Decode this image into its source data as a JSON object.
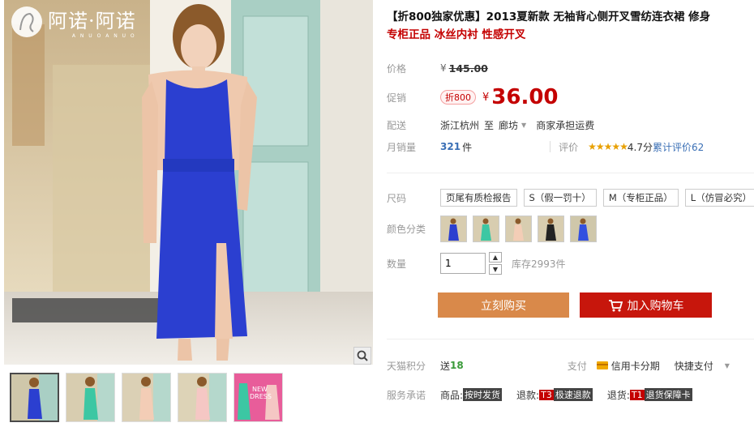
{
  "brand": {
    "name": "阿诺·阿诺",
    "sub": "A N U O A N U O"
  },
  "product": {
    "title": "【折800独家优惠】2013夏新款 无袖背心侧开叉雪纺连衣裙 修身",
    "subtitle": "专柜正品 冰丝内衬 性感开叉"
  },
  "price": {
    "label": "价格",
    "currency": "¥",
    "original": "145.00"
  },
  "promo": {
    "label": "促销",
    "tag": "折800",
    "currency": "¥",
    "price": "36.00"
  },
  "shipping": {
    "label": "配送",
    "from": "浙江杭州",
    "to_word": "至",
    "to": "廊坊",
    "note": "商家承担运费"
  },
  "sales": {
    "label": "月销量",
    "count": "321",
    "unit": "件",
    "rating_label": "评价",
    "stars": "★★★★★",
    "score": "4.7分",
    "review_text": "累计评价",
    "review_count": "62"
  },
  "size": {
    "label": "尺码",
    "options": [
      "页尾有质检报告",
      "S（假一罚十）",
      "M（专柜正品）",
      "L（仿冒必究）"
    ]
  },
  "color": {
    "label": "颜色分类",
    "swatches": [
      "blue",
      "mint",
      "peach",
      "black",
      "blue2"
    ]
  },
  "quantity": {
    "label": "数量",
    "value": "1",
    "stock": "库存2993件",
    "up": "▲",
    "down": "▼"
  },
  "actions": {
    "buy_now": "立刻购买",
    "add_cart": "加入购物车"
  },
  "points": {
    "label": "天猫积分",
    "prefix": "送",
    "value": "18"
  },
  "pay": {
    "label": "支付",
    "card": "信用卡分期",
    "quick": "快捷支付"
  },
  "service": {
    "label": "服务承诺",
    "goods_label": "商品:",
    "goods_badge": "按时发货",
    "refund_label": "退款:",
    "refund_t": "T3",
    "refund_text": "极速退款",
    "return_label": "退货:",
    "return_t": "T1",
    "return_text": "退货保障卡"
  },
  "thumbnails": [
    "blue-dress",
    "mint-dress",
    "peach-dress",
    "pink-dress",
    "new-dress-promo"
  ],
  "new_dress_banner": {
    "line1": "NEW",
    "line2": "DRESS"
  },
  "colors": {
    "promo_red": "#c40000",
    "buy_orange": "#d9894a",
    "cart_red": "#c7160c",
    "dress_blue": "#2b3fd0",
    "sales_blue": "#3a6fb5",
    "star": "#e8a000"
  },
  "icons": {
    "zoom": "magnifier-icon",
    "cart": "cart-icon",
    "card": "credit-card-icon",
    "dropdown": "caret-down-icon"
  }
}
